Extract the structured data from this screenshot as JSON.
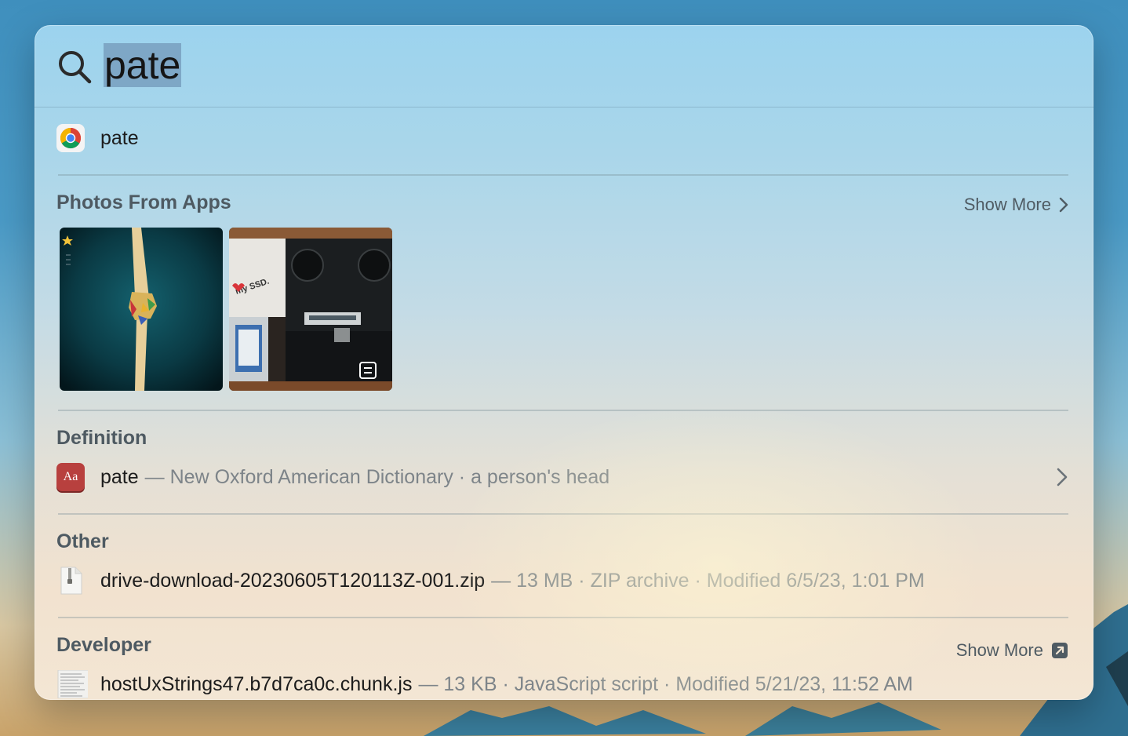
{
  "search": {
    "query": "pate"
  },
  "top_hit": {
    "label": "pate",
    "icon": "chrome-icon"
  },
  "photos_section": {
    "title": "Photos From Apps",
    "show_more": "Show More",
    "photo_overlay_text": "my SSD."
  },
  "definition_section": {
    "title": "Definition",
    "icon_text": "Aa",
    "word": "pate",
    "meta": "— New Oxford American Dictionary · a person's head"
  },
  "other_section": {
    "title": "Other",
    "filename": "drive-download-20230605T120113Z-001.zip",
    "meta": "— 13 MB · ZIP archive · Modified 6/5/23, 1:01 PM"
  },
  "developer_section": {
    "title": "Developer",
    "show_more": "Show More",
    "filename": "hostUxStrings47.b7d7ca0c.chunk.js",
    "meta": "— 13 KB · JavaScript script · Modified 5/21/23, 11:52 AM"
  },
  "colors": {
    "selection": "#7ea7c6",
    "dictionary_red": "#b8403e",
    "meta_gray": "#7d8489"
  }
}
